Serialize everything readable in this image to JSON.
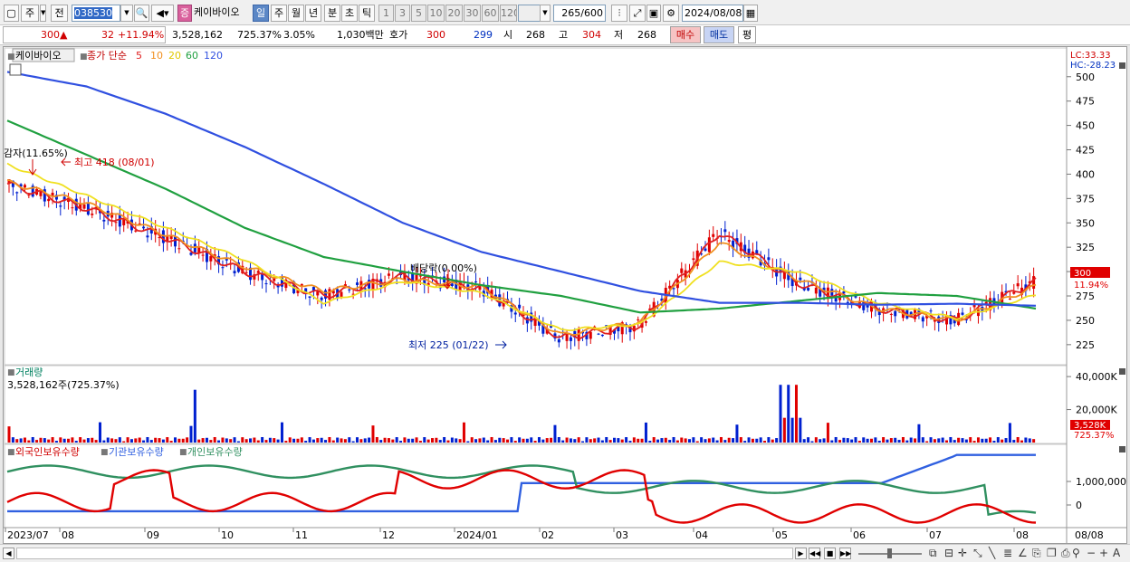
{
  "toolbar": {
    "market": "주",
    "prev": "전",
    "code": "038530",
    "stock_name": "케이바이오",
    "period_day": "일",
    "period_week": "주",
    "period_month": "월",
    "period_year": "년",
    "period_min": "분",
    "period_tick_sec": "초",
    "period_tick": "틱",
    "intervals": [
      "1",
      "3",
      "5",
      "10",
      "20",
      "30",
      "60",
      "120"
    ],
    "count": "265",
    "count_max": "/600",
    "date": "2024/08/08"
  },
  "quote": {
    "price": "300",
    "change": "32",
    "change_pct": "+11.94%",
    "volume": "3,528,162",
    "volume_pct": "725.37%",
    "turnover": "3.05%",
    "amount": "1,030백만",
    "hoga_label": "호가",
    "ask": "300",
    "bid": "299",
    "open_label": "시",
    "open": "268",
    "high_label": "고",
    "high": "304",
    "low_label": "저",
    "low": "268",
    "buy_btn": "매수",
    "sell_btn": "매도",
    "eval_btn": "평"
  },
  "price_panel": {
    "name_label": "케이바이오",
    "ma_label": "종가 단순",
    "ma_periods": [
      "5",
      "10",
      "20",
      "60",
      "120"
    ],
    "lc": "LC:33.33",
    "hc": "HC:-28.23",
    "y_ticks": [
      "500",
      "475",
      "450",
      "425",
      "400",
      "375",
      "350",
      "325",
      "300",
      "275",
      "250",
      "225"
    ],
    "last_price_tag": "300",
    "last_pct_tag": "11.94%",
    "ann_capital": "감자(11.65%)",
    "ann_high": "최고 418 (08/01)",
    "ann_dividend": "배당락(0.00%)",
    "ann_low": "최저 225 (01/22)"
  },
  "volume_panel": {
    "title": "거래량",
    "value_label": "3,528,162주(725.37%)",
    "y_ticks": [
      "40,000K",
      "20,000K"
    ],
    "last_tag": "3,528K",
    "last_pct": "725.37%"
  },
  "holdings_panel": {
    "legend_foreign": "외국인보유수량",
    "legend_inst": "기관보유수량",
    "legend_indiv": "개인보유수량",
    "y_ticks": [
      "1,000,000",
      "0"
    ]
  },
  "x_axis": {
    "labels": [
      "2023/07",
      "08",
      "09",
      "10",
      "11",
      "12",
      "2024/01",
      "02",
      "03",
      "04",
      "05",
      "06",
      "07",
      "08"
    ],
    "last_label": "08/08"
  },
  "colors": {
    "ma5": "#e02020",
    "ma10": "#f09020",
    "ma20": "#f0e020",
    "ma60": "#20a040",
    "ma120": "#3050e0",
    "up": "#e00000",
    "down": "#0020d0",
    "foreign": "#e00000",
    "inst": "#3060e0",
    "indiv": "#309060"
  },
  "chart_data": {
    "type": "line",
    "x": [
      "2023/07",
      "08",
      "09",
      "10",
      "11",
      "12",
      "2024/01",
      "02",
      "03",
      "04",
      "05",
      "06",
      "07",
      "08"
    ],
    "series": [
      {
        "name": "5",
        "values": [
          390,
          365,
          335,
          300,
          275,
          295,
          283,
          232,
          245,
          340,
          288,
          262,
          250,
          290
        ]
      },
      {
        "name": "10",
        "values": [
          392,
          370,
          338,
          305,
          280,
          292,
          284,
          235,
          248,
          330,
          292,
          262,
          250,
          285
        ]
      },
      {
        "name": "20",
        "values": [
          410,
          378,
          345,
          312,
          268,
          290,
          278,
          240,
          246,
          310,
          300,
          268,
          252,
          276
        ]
      },
      {
        "name": "60",
        "values": [
          455,
          420,
          385,
          345,
          315,
          300,
          286,
          275,
          258,
          262,
          270,
          278,
          275,
          262
        ]
      },
      {
        "name": "120",
        "values": [
          505,
          490,
          462,
          428,
          390,
          350,
          320,
          300,
          280,
          268,
          268,
          266,
          267,
          265
        ]
      }
    ],
    "ylim": [
      210,
      510
    ],
    "current_price": 300,
    "period_high": {
      "value": 418,
      "date": "08/01"
    },
    "period_low": {
      "value": 225,
      "date": "01/22"
    },
    "volume_ylim": [
      0,
      45000
    ],
    "volume_unit": "K"
  }
}
